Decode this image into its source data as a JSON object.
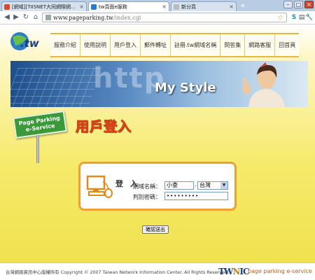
{
  "browser": {
    "tabs": [
      {
        "label": "[網域][TIISNET大同網際網...",
        "active": false,
        "icon_color": "#d24b2a"
      },
      {
        "label": "tw頁面e服務",
        "active": true,
        "icon_color": "#2a7cc8"
      },
      {
        "label": "新分頁",
        "active": false,
        "icon_color": "#bbbbbb"
      }
    ],
    "new_tab": "+",
    "window_buttons": {
      "minimize": "–",
      "maximize": "□",
      "close": "×"
    },
    "url_host": "www.pageparking.tw",
    "url_path": "/index.cgi",
    "nav_icons": {
      "back": "◀",
      "forward": "▶",
      "reload": "↻",
      "home": "⌂",
      "star": "☆",
      "skype": "S",
      "page": "▤",
      "wrench": "🔧"
    }
  },
  "site": {
    "logo_text": ".tw",
    "menu": [
      "服務介紹",
      "使用說明",
      "用戶登入",
      "郵件轉址",
      "註冊.tw網域名稱",
      "問答集",
      "網路客服",
      "回首頁"
    ],
    "banner_http": "http",
    "banner_style": "My Style",
    "sign_lines": [
      "Page Parking",
      "e-Service"
    ],
    "login_title": "用戶登入",
    "login": {
      "label": "登 入",
      "domain_label": "網域名稱：",
      "domain_value": "小查",
      "dot": ".",
      "tld_value": "台灣",
      "password_label": "判別密碼：",
      "password_value": "•••••••••"
    },
    "submit_label": "確認送出",
    "copyright": "台灣網路資訊中心版權所有 Copyright © 2007 Taiwan Network Information Center. All Rights Reserved.",
    "footer_logo": "TWNIC",
    "footer_tag": "page parking e-service"
  }
}
